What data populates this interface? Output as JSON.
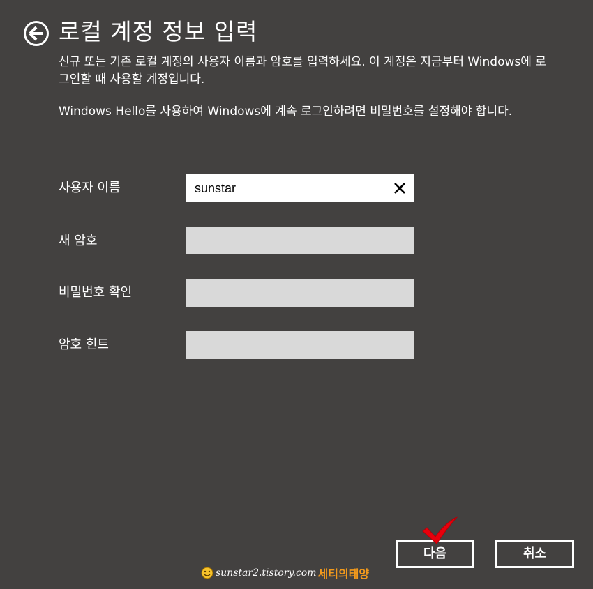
{
  "header": {
    "title": "로컬 계정 정보 입력",
    "back_icon": "back-arrow-circle-icon"
  },
  "description": {
    "line1": "신규 또는 기존 로컬 계정의 사용자 이름과 암호를 입력하세요. 이 계정은 지금부터 Windows에 로그인할 때 사용할 계정입니다.",
    "line2": "Windows Hello를 사용하여 Windows에 계속 로그인하려면 비밀번호를 설정해야 합니다."
  },
  "form": {
    "username": {
      "label": "사용자 이름",
      "value": "sunstar",
      "clear_icon": "close-icon"
    },
    "new_password": {
      "label": "새 암호",
      "value": ""
    },
    "confirm_password": {
      "label": "비밀번호 확인",
      "value": ""
    },
    "password_hint": {
      "label": "암호 힌트",
      "value": ""
    }
  },
  "buttons": {
    "next_label": "다음",
    "cancel_label": "취소"
  },
  "annotation": {
    "checkmark_icon": "red-checkmark-icon",
    "checkmark_color": "#e8000c"
  },
  "watermark": {
    "url": "sunstar2.tistory.com",
    "name": "세티의태양",
    "name_color": "#f39a1c"
  },
  "colors": {
    "background": "#434140",
    "field_disabled": "#d9d9d9",
    "field_active": "#ffffff",
    "text": "#ffffff"
  }
}
